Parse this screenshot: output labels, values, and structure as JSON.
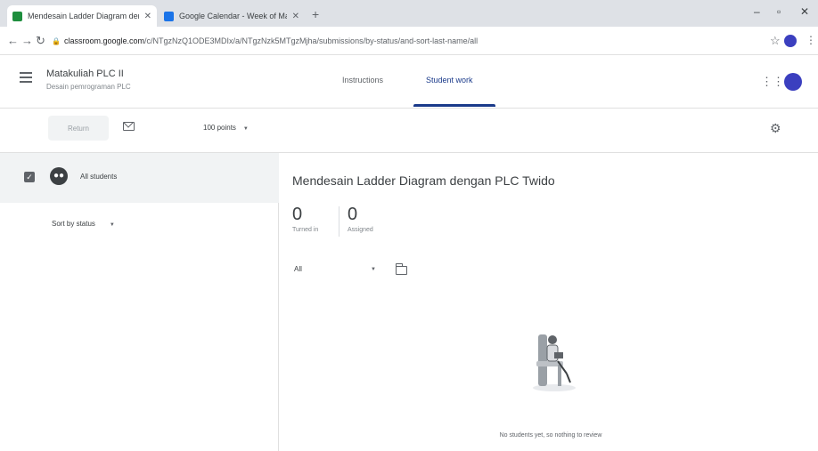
{
  "browser": {
    "tabs": [
      {
        "title": "Mendesain Ladder Diagram den...",
        "active": true,
        "favicon_color": "#1e8e3e"
      },
      {
        "title": "Google Calendar - Week of Ma...",
        "active": false,
        "favicon_color": "#1a73e8"
      }
    ],
    "url_host": "classroom.google.com",
    "url_path": "/c/NTgzNzQ1ODE3MDIx/a/NTgzNzk5MTgzMjha/submissions/by-status/and-sort-last-name/all"
  },
  "header": {
    "class_name": "Matakuliah PLC II",
    "class_subtitle": "Desain pemrograman PLC",
    "tabs": [
      "Instructions",
      "Student work"
    ],
    "active_tab": "Student work"
  },
  "toolbar": {
    "return_label": "Return",
    "points_label": "100 points"
  },
  "sidebar": {
    "all_students_label": "All students",
    "sort_label": "Sort by status"
  },
  "main": {
    "assignment_title": "Mendesain Ladder Diagram dengan PLC Twido",
    "turned_in_count": "0",
    "turned_in_label": "Turned in",
    "assigned_count": "0",
    "assigned_label": "Assigned",
    "filter_label": "All",
    "empty_message": "No students yet, so nothing to review"
  },
  "colors": {
    "accent": "#1a3a8a",
    "avatar": "#3b3fbf"
  }
}
